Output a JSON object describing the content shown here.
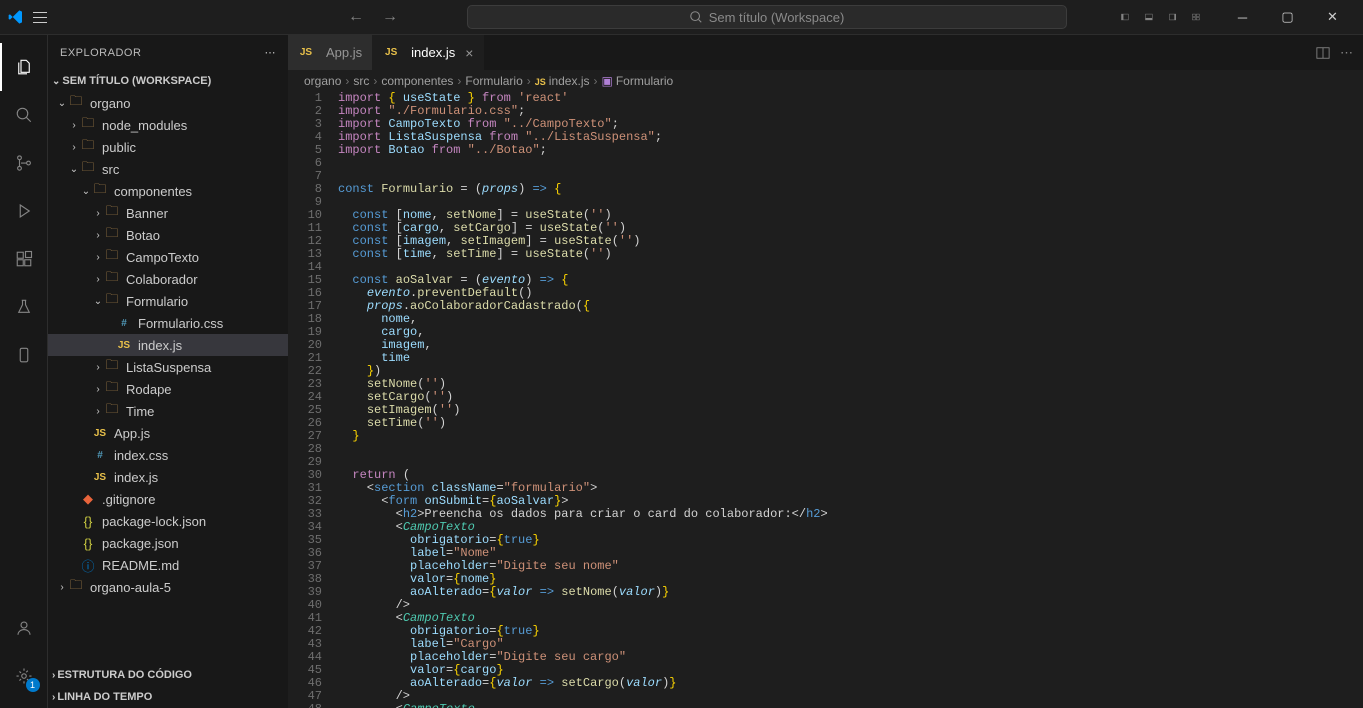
{
  "titlebar": {
    "search_placeholder": "Sem título (Workspace)"
  },
  "sidebar": {
    "title": "EXPLORADOR",
    "workspace": "SEM TÍTULO (WORKSPACE)",
    "tree": [
      {
        "label": "organo",
        "depth": 0,
        "type": "folder-open",
        "chev": "v"
      },
      {
        "label": "node_modules",
        "depth": 1,
        "type": "folder",
        "chev": ">"
      },
      {
        "label": "public",
        "depth": 1,
        "type": "folder",
        "chev": ">"
      },
      {
        "label": "src",
        "depth": 1,
        "type": "folder-open",
        "chev": "v"
      },
      {
        "label": "componentes",
        "depth": 2,
        "type": "folder-open",
        "chev": "v"
      },
      {
        "label": "Banner",
        "depth": 3,
        "type": "folder",
        "chev": ">"
      },
      {
        "label": "Botao",
        "depth": 3,
        "type": "folder",
        "chev": ">"
      },
      {
        "label": "CampoTexto",
        "depth": 3,
        "type": "folder",
        "chev": ">"
      },
      {
        "label": "Colaborador",
        "depth": 3,
        "type": "folder",
        "chev": ">"
      },
      {
        "label": "Formulario",
        "depth": 3,
        "type": "folder-open",
        "chev": "v"
      },
      {
        "label": "Formulario.css",
        "depth": 4,
        "type": "css",
        "chev": ""
      },
      {
        "label": "index.js",
        "depth": 4,
        "type": "js",
        "chev": "",
        "selected": true
      },
      {
        "label": "ListaSuspensa",
        "depth": 3,
        "type": "folder",
        "chev": ">"
      },
      {
        "label": "Rodape",
        "depth": 3,
        "type": "folder",
        "chev": ">"
      },
      {
        "label": "Time",
        "depth": 3,
        "type": "folder",
        "chev": ">"
      },
      {
        "label": "App.js",
        "depth": 2,
        "type": "js",
        "chev": ""
      },
      {
        "label": "index.css",
        "depth": 2,
        "type": "css",
        "chev": ""
      },
      {
        "label": "index.js",
        "depth": 2,
        "type": "js",
        "chev": ""
      },
      {
        "label": ".gitignore",
        "depth": 1,
        "type": "git",
        "chev": ""
      },
      {
        "label": "package-lock.json",
        "depth": 1,
        "type": "json",
        "chev": ""
      },
      {
        "label": "package.json",
        "depth": 1,
        "type": "json",
        "chev": ""
      },
      {
        "label": "README.md",
        "depth": 1,
        "type": "md",
        "chev": ""
      },
      {
        "label": "organo-aula-5",
        "depth": 0,
        "type": "folder",
        "chev": ">"
      }
    ],
    "outline": "ESTRUTURA DO CÓDIGO",
    "timeline": "LINHA DO TEMPO"
  },
  "tabs": [
    {
      "label": "App.js",
      "icon": "js",
      "active": false
    },
    {
      "label": "index.js",
      "icon": "js",
      "active": true
    }
  ],
  "breadcrumb": [
    "organo",
    "src",
    "componentes",
    "Formulario",
    "index.js",
    "Formulario"
  ],
  "settings_badge": "1",
  "code": {
    "lines": 48
  }
}
